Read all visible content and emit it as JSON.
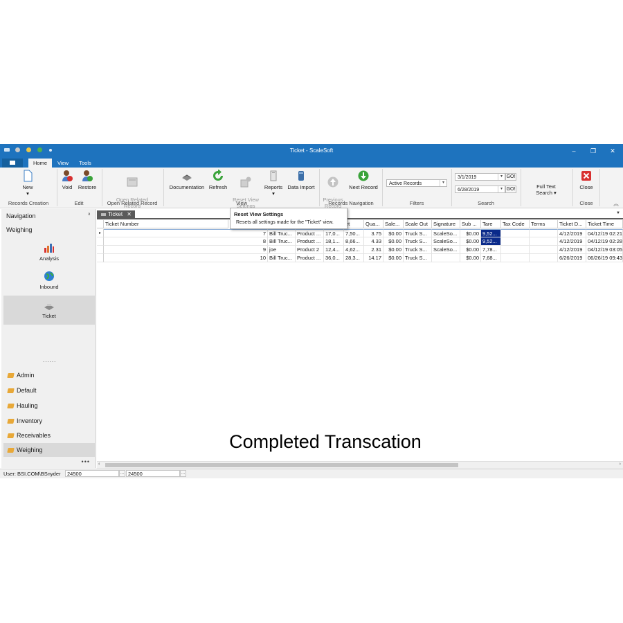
{
  "window": {
    "title": "Ticket - ScaleSoft",
    "controls": {
      "minimize": "–",
      "restore": "❐",
      "close": "✕"
    }
  },
  "ribbon_tabs": [
    {
      "label": "Home",
      "active": true
    },
    {
      "label": "View",
      "active": false
    },
    {
      "label": "Tools",
      "active": false
    }
  ],
  "ribbon": {
    "new_label": "New",
    "new_arrow": "▾",
    "void_label": "Void",
    "restore_label": "Restore",
    "open_related_label": "Open Related\nRecord",
    "documentation_label": "Documentation",
    "refresh_label": "Refresh",
    "reset_view_label": "Reset View\nSettings",
    "reports_label": "Reports",
    "reports_arrow": "▾",
    "data_import_label": "Data Import",
    "previous_record_label": "Previous\nRecord",
    "next_record_label": "Next Record",
    "filter_value": "Active Records",
    "search_from": "3/1/2019",
    "search_to": "6/28/2019",
    "go_label": "GO!",
    "full_text_label": "Full Text\nSearch ▾",
    "close_label": "Close",
    "groups": {
      "records_creation": "Records Creation",
      "edit": "Edit",
      "open_related": "Open Related Record",
      "view": "View",
      "records_navigation": "Records Navigation",
      "filters": "Filters",
      "search": "Search",
      "close": "Close"
    },
    "collapse_icon": "︽"
  },
  "nav": {
    "header": "Navigation",
    "pin": "ᵃ",
    "section": "Weighing",
    "tiles": [
      {
        "label": "Analysis"
      },
      {
        "label": "Inbound"
      },
      {
        "label": "Ticket"
      }
    ],
    "dots": "......",
    "modules": [
      "Admin",
      "Default",
      "Hauling",
      "Inventory",
      "Receivables",
      "Weighing"
    ],
    "more": "•••"
  },
  "doc_tab": {
    "label": "Ticket",
    "close": "✕",
    "menu": "▼"
  },
  "tooltip": {
    "title": "Reset View Settings",
    "text": "Resets all settings made for the \"Ticket\" view."
  },
  "grid": {
    "columns": [
      "Ticket Number",
      "",
      "",
      "et",
      "Qua...",
      "Sale...",
      "Scale Out",
      "Signature",
      "Sub ...",
      "Tare",
      "Tax Code",
      "Terms",
      "Ticket D...",
      "Ticket Time"
    ],
    "rows": [
      [
        "7",
        "Bill Truc...",
        "Product ...",
        "17,0...",
        "7,50...",
        "3.75",
        "$0.00",
        "Truck S...",
        "ScaleSo...",
        "$0.00",
        "9,52...",
        "",
        "",
        "4/12/2019",
        "04/12/19 02:21"
      ],
      [
        "8",
        "Bill Truc...",
        "Product ...",
        "18,1...",
        "8,66...",
        "4.33",
        "$0.00",
        "Truck S...",
        "ScaleSo...",
        "$0.00",
        "9,52...",
        "",
        "",
        "4/12/2019",
        "04/12/19 02:28"
      ],
      [
        "9",
        "joe",
        "Product 2",
        "12,4...",
        "4,62...",
        "2.31",
        "$0.00",
        "Truck S...",
        "ScaleSo...",
        "$0.00",
        "7,78...",
        "",
        "",
        "4/12/2019",
        "04/12/19 03:05"
      ],
      [
        "10",
        "Bill Truc...",
        "Product ...",
        "36,0...",
        "28,3...",
        "14.17",
        "$0.00",
        "Truck S...",
        "",
        "$0.00",
        "7,68...",
        "",
        "",
        "6/26/2019",
        "06/26/19 09:43"
      ]
    ],
    "row_indicator": "▸"
  },
  "scroll": {
    "left": "‹",
    "right": "›"
  },
  "status": {
    "user": "User: BSI.COM\\BSnyder",
    "field1": "24500",
    "field2": "24500",
    "btn": "..."
  },
  "caption": "Completed Transcation",
  "colors": {
    "accent": "#1e73be",
    "selection": "#0a2a8a"
  }
}
